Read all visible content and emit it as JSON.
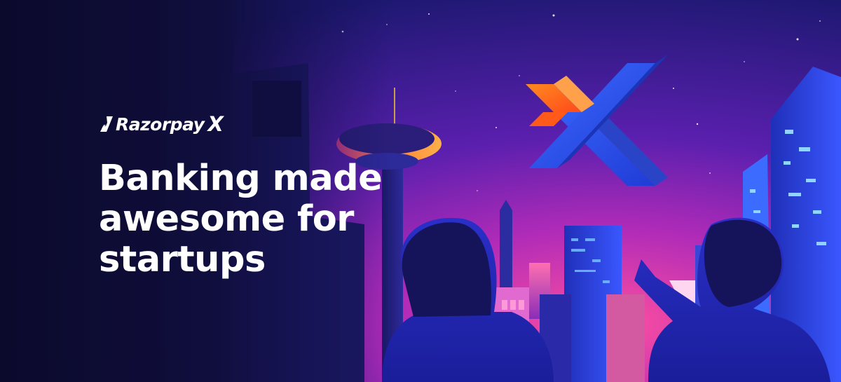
{
  "brand": {
    "name": "Razorpay",
    "suffix": "X"
  },
  "headline": {
    "lines": [
      "Banking made",
      "awesome for",
      "startups"
    ]
  },
  "colors": {
    "sky_top": "#1b1a6e",
    "sky_mid": "#5b1aa8",
    "horizon": "#e43b9a",
    "x_orange": "#ff6a1a",
    "x_blue": "#2f5bff",
    "text": "#ffffff"
  }
}
